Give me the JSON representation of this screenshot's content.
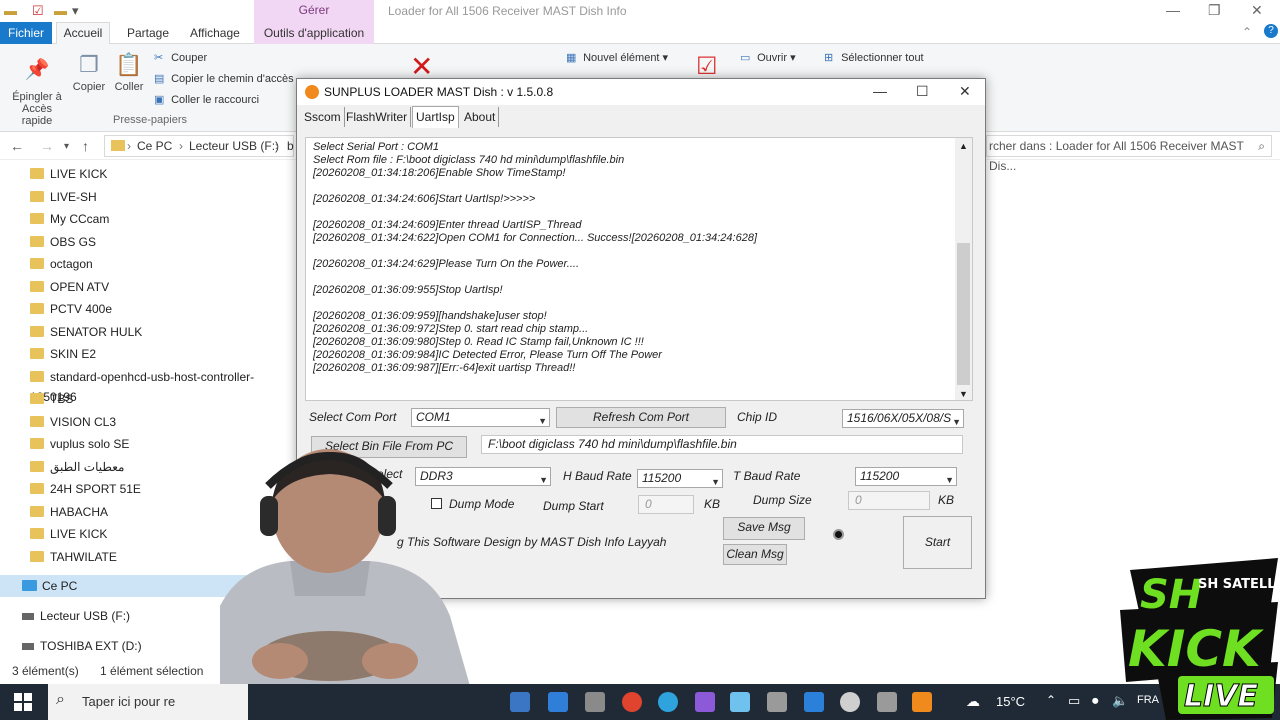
{
  "explorer": {
    "context_tab": "Gérer",
    "window_title": "Loader for All 1506 Receiver MAST Dish Info",
    "tabs": [
      "Fichier",
      "Accueil",
      "Partage",
      "Affichage",
      "Outils d'application"
    ],
    "ribbon": {
      "pin": "Épingler à\nAccès rapide",
      "copy": "Copier",
      "paste": "Coller",
      "cut": "Couper",
      "copy_path": "Copier le chemin d'accès",
      "paste_shortcut": "Coller le raccourci",
      "group_clipboard": "Presse-papiers",
      "new_item": "Nouvel élément",
      "open": "Ouvrir",
      "select_all": "Sélectionner tout"
    },
    "breadcrumb": [
      "Ce PC",
      "Lecteur USB (F:)",
      "b"
    ],
    "search_placeholder": "rcher dans : Loader for All 1506 Receiver MAST Dis...",
    "folders": [
      "LIVE KICK",
      "LIVE-SH",
      "My CCcam",
      "OBS GS",
      "octagon",
      "OPEN ATV",
      "PCTV 400e",
      "SENATOR HULK",
      "SKIN E2",
      "standard-openhcd-usb-host-controller-1250196",
      "TBS",
      "VISION CL3",
      "vuplus solo SE",
      "معطيات الطبق",
      "24H SPORT 51E",
      "HABACHA",
      "LIVE KICK",
      "TAHWILATE"
    ],
    "this_pc": "Ce PC",
    "drives": [
      "Lecteur USB (F:)",
      "TOSHIBA EXT (D:)"
    ],
    "status_count": "3 élément(s)",
    "status_selected": "1 élément sélection"
  },
  "app": {
    "title": "SUNPLUS LOADER MAST Dish : v 1.5.0.8",
    "tabs": [
      "Sscom",
      "FlashWriter",
      "UartIsp",
      "About"
    ],
    "log": [
      "Select Serial Port : COM1",
      "Select Rom file : F:\\boot digiclass 740 hd mini\\dump\\flashfile.bin",
      "[20260208_01:34:18:206]Enable Show TimeStamp!",
      "",
      "[20260208_01:34:24:606]Start UartIsp!>>>>>",
      "",
      "[20260208_01:34:24:609]Enter thread UartISP_Thread",
      "[20260208_01:34:24:622]Open COM1 for Connection... Success![20260208_01:34:24:628]",
      "",
      "[20260208_01:34:24:629]Please Turn On the Power....",
      "",
      "[20260208_01:36:09:955]Stop UartIsp!",
      "",
      "[20260208_01:36:09:959][handshake]user stop!",
      "[20260208_01:36:09:972]Step 0. start read chip stamp...",
      "[20260208_01:36:09:980]Step 0. Read IC Stamp fail,Unknown IC !!!",
      "[20260208_01:36:09:984]IC Detected Error, Please Turn Off The Power",
      "[20260208_01:36:09:987][Err:-64]exit uartisp Thread!!"
    ],
    "select_com_label": "Select Com Port",
    "com_value": "COM1",
    "refresh_btn": "Refresh Com Port",
    "chip_id_label": "Chip ID",
    "chip_id_value": "1516/06X/05X/08/S",
    "select_bin_btn": "Select Bin File From PC",
    "bin_path": "F:\\boot digiclass 740 hd mini\\dump\\flashfile.bin",
    "select_label": "Select",
    "ddr_value": "DDR3",
    "h_baud_label": "H Baud Rate",
    "h_baud_value": "115200",
    "t_baud_label": "T Baud Rate",
    "t_baud_value": "115200",
    "dump_mode_label": "Dump Mode",
    "dump_start_label": "Dump Start",
    "dump_start_value": "0",
    "kb1": "KB",
    "dump_size_label": "Dump Size",
    "dump_size_value": "0",
    "kb2": "KB",
    "save_msg": "Save Msg",
    "clean_msg": "Clean Msg",
    "footer_text": "g This Software Design by MAST Dish Info Layyah",
    "start": "Start"
  },
  "taskbar": {
    "search_placeholder": "Taper ici pour re",
    "temperature": "15°C",
    "language": "FRA"
  },
  "overlay": {
    "brand_top": "SH",
    "brand_sub": "SH SATELLITE",
    "brand_main": "KICK",
    "brand_live": "LIVE"
  }
}
